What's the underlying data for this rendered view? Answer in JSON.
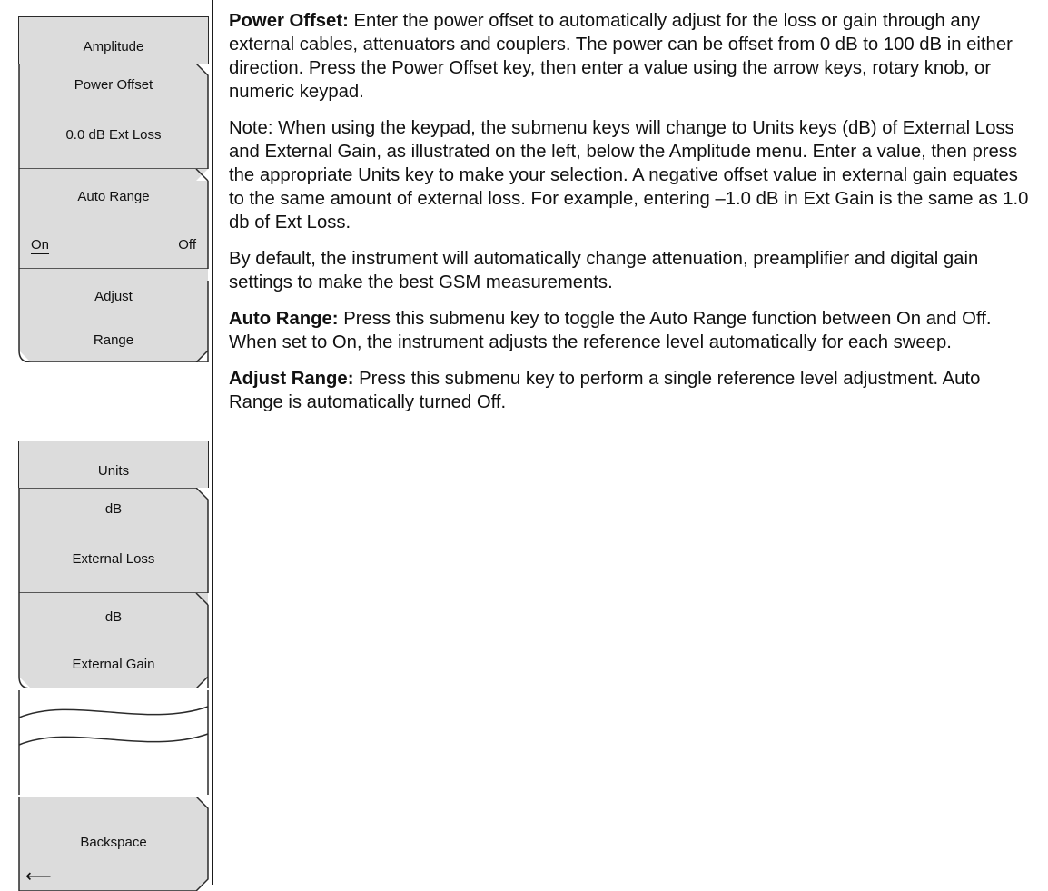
{
  "amplitude_menu": {
    "title": "Amplitude",
    "power_offset": {
      "label": "Power Offset",
      "value": "0.0 dB Ext Loss"
    },
    "auto_range": {
      "label": "Auto Range",
      "on": "On",
      "off": "Off",
      "selected": "On"
    },
    "adjust_range": {
      "line1": "Adjust",
      "line2": "Range"
    }
  },
  "units_menu": {
    "title": "Units",
    "external_loss": {
      "line1": "dB",
      "line2": "External Loss"
    },
    "external_gain": {
      "line1": "dB",
      "line2": "External Gain"
    },
    "backspace": {
      "label": "Backspace",
      "arrow": "⟵"
    }
  },
  "text": {
    "power_offset_term": "Power Offset:",
    "power_offset_desc": " Enter the power offset to automatically adjust for the loss or gain through any external cables, attenuators and couplers. The power can be offset from 0 dB to 100 dB in either direction. Press the Power Offset key, then enter a value using the arrow keys, rotary knob, or numeric keypad.",
    "note": "Note: When using the keypad, the submenu keys will change to Units keys (dB) of External Loss and External Gain, as illustrated on the left, below the Amplitude menu. Enter a value, then press the appropriate Units key to make your selection. A negative offset value in external gain equates to the same amount of external loss. For example, entering –1.0 dB in Ext Gain is the same as 1.0 db of Ext Loss.",
    "default": "By default, the instrument will automatically change attenuation, preamplifier and digital gain settings to make the best GSM measurements.",
    "auto_range_term": "Auto Range:",
    "auto_range_desc": " Press this submenu key to toggle the Auto Range function between On and Off. When set to On, the instrument adjusts the reference level automatically for each sweep.",
    "adjust_range_term": "Adjust Range:",
    "adjust_range_desc": " Press this submenu key to perform a single reference level adjustment. Auto Range is automatically turned Off."
  }
}
